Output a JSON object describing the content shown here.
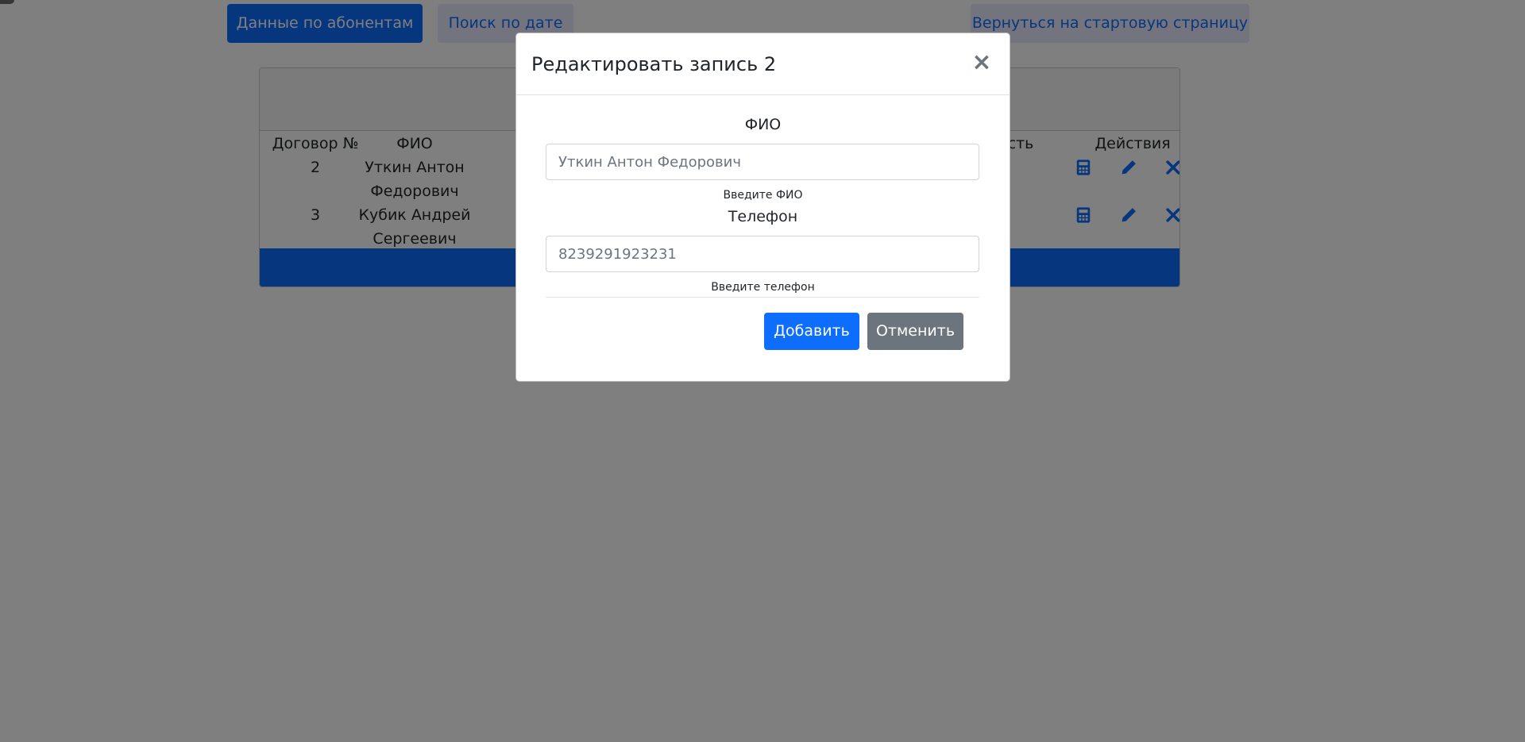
{
  "nav": {
    "subscribers_label": "Данные по абонентам",
    "date_search_label": "Поиск по дате",
    "home_label": "Вернуться на стартовую страницу"
  },
  "table": {
    "headers": {
      "contract": "Договор №",
      "name": "ФИО",
      "cost_fragment": "ость",
      "actions": "Действия"
    },
    "rows": [
      {
        "contract": "2",
        "name_line1": "Уткин Антон",
        "name_line2": "Федорович"
      },
      {
        "contract": "3",
        "name_line1": "Кубик Андрей",
        "name_line2": "Сергеевич"
      }
    ],
    "row_icons": [
      "calculator-icon",
      "pencil-icon",
      "close-icon"
    ]
  },
  "modal": {
    "title": "Редактировать запись 2",
    "close_symbol": "×",
    "fio_label": "ФИО",
    "fio_value": "Уткин Антон Федорович",
    "fio_help": "Введите ФИО",
    "phone_label": "Телефон",
    "phone_value": "8239291923231",
    "phone_help": "Введите телефон",
    "add_button": "Добавить",
    "cancel_button": "Отменить"
  },
  "colors": {
    "primary": "#0d6efd",
    "secondary": "#6c757d",
    "backdrop": "rgba(0,0,0,0.5)"
  }
}
